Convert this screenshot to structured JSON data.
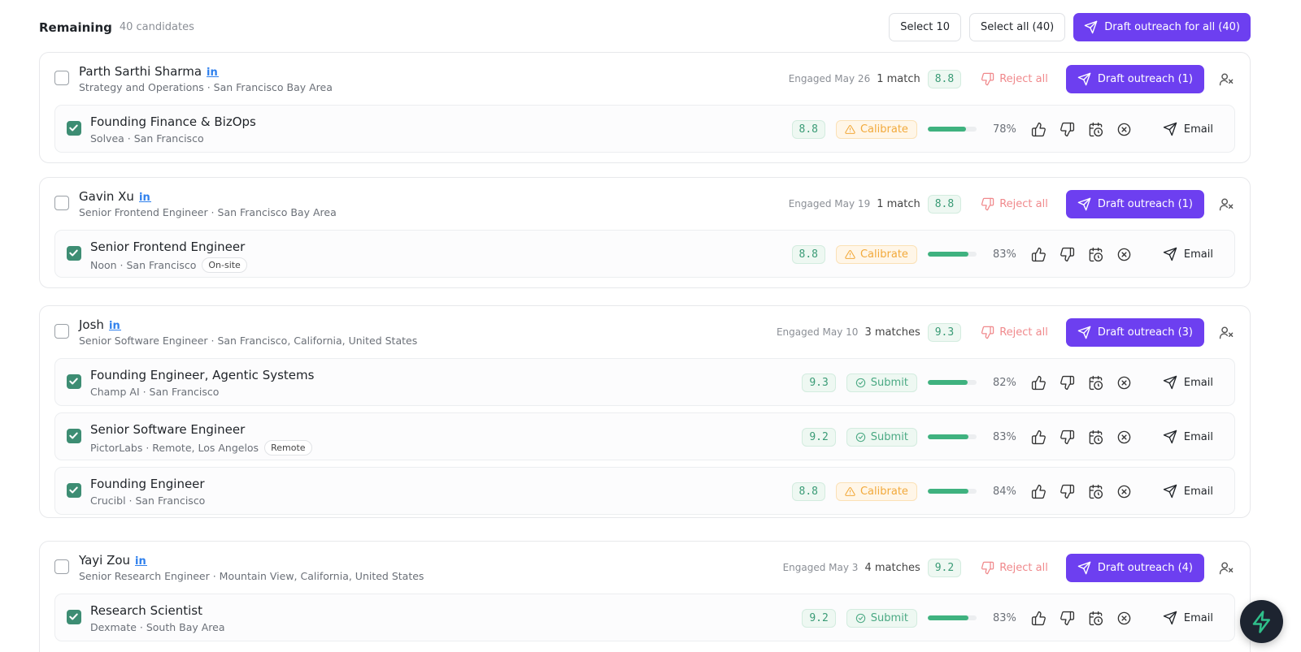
{
  "header": {
    "title": "Remaining",
    "count": "40 candidates",
    "select_10": "Select 10",
    "select_all": "Select all (40)",
    "draft_all": "Draft outreach for all (40)"
  },
  "labels": {
    "reject_all": "Reject all",
    "email": "Email"
  },
  "colors": {
    "primary": "#6d3ff0",
    "score_green": "#3a9b76",
    "calibrate": "#f2a93b",
    "submit": "#4aa983",
    "reject": "#f0898c",
    "checkbox": "#3d8d73"
  },
  "candidates": [
    {
      "name": "Parth Sarthi Sharma",
      "subtitle": "Strategy and Operations · San Francisco Bay Area",
      "engaged": "Engaged May 26",
      "matches": "1 match",
      "score": "8.8",
      "draft": "Draft outreach (1)",
      "jobs": [
        {
          "title": "Founding Finance & BizOps",
          "subtitle": "Solvea · San Francisco",
          "tag": "",
          "score": "8.8",
          "status": "Calibrate",
          "status_type": "calibrate",
          "progress": 78,
          "pct": "78%"
        }
      ]
    },
    {
      "name": "Gavin Xu",
      "subtitle": "Senior Frontend Engineer · San Francisco Bay Area",
      "engaged": "Engaged May 19",
      "matches": "1 match",
      "score": "8.8",
      "draft": "Draft outreach (1)",
      "jobs": [
        {
          "title": "Senior Frontend Engineer",
          "subtitle": "Noon · San Francisco",
          "tag": "On-site",
          "score": "8.8",
          "status": "Calibrate",
          "status_type": "calibrate",
          "progress": 83,
          "pct": "83%"
        }
      ]
    },
    {
      "name": "Josh",
      "subtitle": "Senior Software Engineer · San Francisco, California, United States",
      "engaged": "Engaged May 10",
      "matches": "3 matches",
      "score": "9.3",
      "draft": "Draft outreach (3)",
      "jobs": [
        {
          "title": "Founding Engineer, Agentic Systems",
          "subtitle": "Champ AI · San Francisco",
          "tag": "",
          "score": "9.3",
          "status": "Submit",
          "status_type": "submit",
          "progress": 82,
          "pct": "82%"
        },
        {
          "title": "Senior Software Engineer",
          "subtitle": "PictorLabs · Remote, Los Angelos",
          "tag": "Remote",
          "score": "9.2",
          "status": "Submit",
          "status_type": "submit",
          "progress": 83,
          "pct": "83%"
        },
        {
          "title": "Founding Engineer",
          "subtitle": "Crucibl · San Francisco",
          "tag": "",
          "score": "8.8",
          "status": "Calibrate",
          "status_type": "calibrate",
          "progress": 84,
          "pct": "84%"
        }
      ]
    },
    {
      "name": "Yayi Zou",
      "subtitle": "Senior Research Engineer · Mountain View, California, United States",
      "engaged": "Engaged May 3",
      "matches": "4 matches",
      "score": "9.2",
      "draft": "Draft outreach (4)",
      "jobs": [
        {
          "title": "Research Scientist",
          "subtitle": "Dexmate · South Bay Area",
          "tag": "",
          "score": "9.2",
          "status": "Submit",
          "status_type": "submit",
          "progress": 83,
          "pct": "83%"
        }
      ]
    }
  ]
}
